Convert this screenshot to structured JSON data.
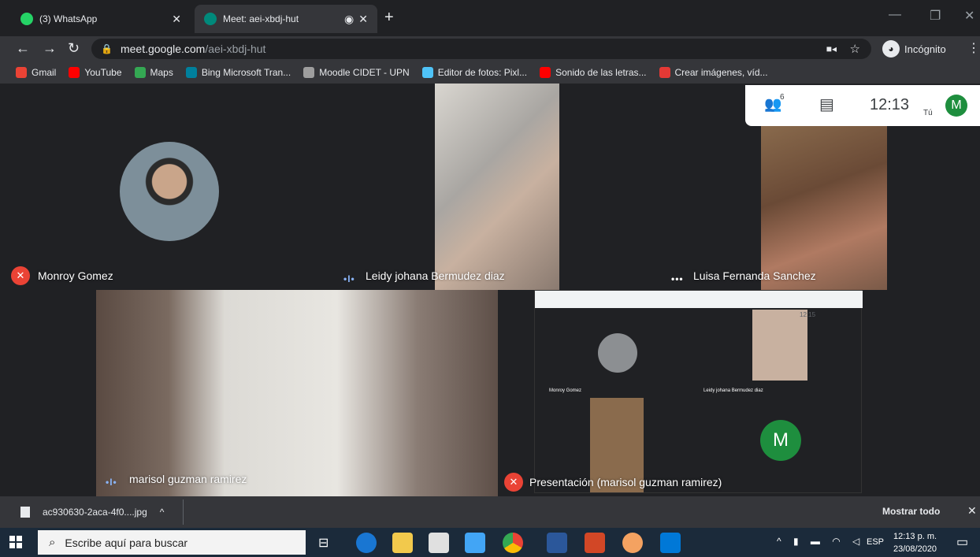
{
  "tabs": [
    {
      "title": "(3) WhatsApp",
      "active": false,
      "favicon_color": "#25d366"
    },
    {
      "title": "Meet: aei-xbdj-hut",
      "active": true,
      "favicon_color": "#00897b"
    }
  ],
  "address": {
    "host": "meet.google.com",
    "path": "/aei-xbdj-hut"
  },
  "incognito_label": "Incógnito",
  "bookmarks": [
    {
      "label": "Gmail",
      "color": "#ea4335"
    },
    {
      "label": "YouTube",
      "color": "#ff0000"
    },
    {
      "label": "Maps",
      "color": "#34a853"
    },
    {
      "label": "Bing Microsoft Tran...",
      "color": "#00809d"
    },
    {
      "label": "Moodle CIDET - UPN",
      "color": "#f98012"
    },
    {
      "label": "Editor de fotos: Pixl...",
      "color": "#4fc3f7"
    },
    {
      "label": "Sonido de las letras...",
      "color": "#ff0000"
    },
    {
      "label": "Crear imágenes, víd...",
      "color": "#e53935"
    }
  ],
  "meet": {
    "time": "12:13",
    "self_label": "Tú",
    "self_initial": "M",
    "participants_count": "6",
    "participants": [
      {
        "name": "Monroy Gomez",
        "status": "muted"
      },
      {
        "name": "Leidy johana Bermudez diaz",
        "status": "speaking"
      },
      {
        "name": "Luisa Fernanda Sanchez",
        "status": "more"
      },
      {
        "name": "marisol guzman ramirez",
        "status": "speaking"
      },
      {
        "name": "Presentación (marisol guzman ramirez)",
        "status": "muted"
      }
    ],
    "presentation": {
      "initial": "M",
      "mini_time": "12:15",
      "mini_names": [
        "Monroy Gomez",
        "Leidy johana Bermudez diaz"
      ]
    }
  },
  "download": {
    "filename": "ac930630-2aca-4f0....jpg",
    "show_all": "Mostrar todo"
  },
  "taskbar": {
    "search_placeholder": "Escribe aquí para buscar",
    "lang": "ESP",
    "time": "12:13 p. m.",
    "date": "23/08/2020"
  }
}
